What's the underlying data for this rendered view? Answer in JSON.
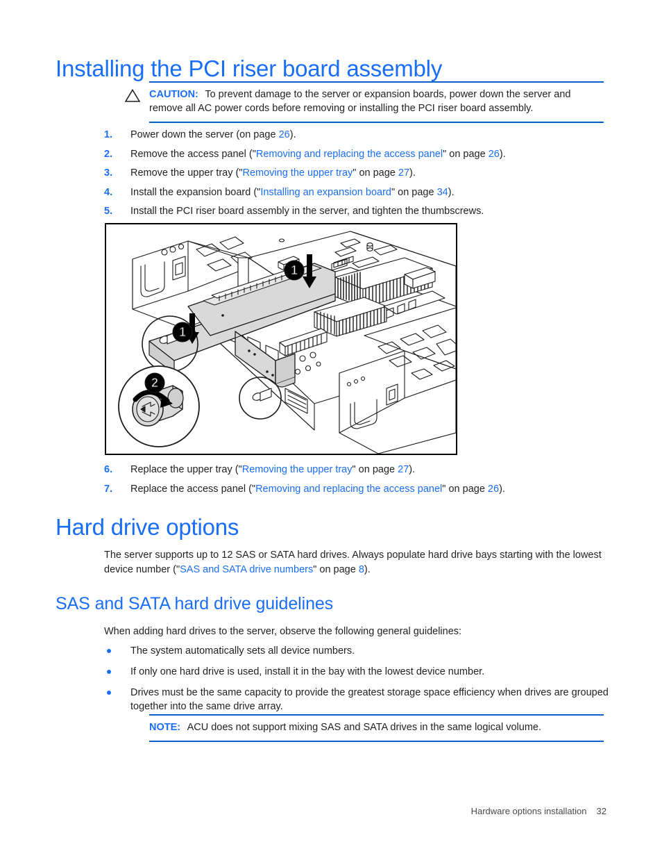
{
  "document": {
    "section_title": "Installing the PCI riser board assembly",
    "caution": {
      "label": "CAUTION:",
      "text": "To prevent damage to the server or expansion boards, power down the server and remove all AC power cords before removing or installing the PCI riser board assembly.",
      "icon": "warning-triangle-icon"
    },
    "steps_before_figure": [
      {
        "number": "1.",
        "parts": [
          {
            "type": "text",
            "value": "Power down the server (on page "
          },
          {
            "type": "link",
            "value": "26"
          },
          {
            "type": "text",
            "value": ")."
          }
        ]
      },
      {
        "number": "2.",
        "parts": [
          {
            "type": "text",
            "value": "Remove the access panel (\""
          },
          {
            "type": "link",
            "value": "Removing and replacing the access panel"
          },
          {
            "type": "text",
            "value": "\" on page "
          },
          {
            "type": "link",
            "value": "26"
          },
          {
            "type": "text",
            "value": ")."
          }
        ]
      },
      {
        "number": "3.",
        "parts": [
          {
            "type": "text",
            "value": "Remove the upper tray (\""
          },
          {
            "type": "link",
            "value": "Removing the upper tray"
          },
          {
            "type": "text",
            "value": "\" on page "
          },
          {
            "type": "link",
            "value": "27"
          },
          {
            "type": "text",
            "value": ")."
          }
        ]
      },
      {
        "number": "4.",
        "parts": [
          {
            "type": "text",
            "value": "Install the expansion board (\""
          },
          {
            "type": "link",
            "value": "Installing an expansion board"
          },
          {
            "type": "text",
            "value": "\" on page "
          },
          {
            "type": "link",
            "value": "34"
          },
          {
            "type": "text",
            "value": ")."
          }
        ]
      },
      {
        "number": "5.",
        "parts": [
          {
            "type": "text",
            "value": "Install the PCI riser board assembly in the server, and tighten the thumbscrews."
          }
        ]
      }
    ],
    "figure": {
      "alt": "Exploded view of server chassis showing PCI riser board assembly being lowered into the server and a magnified detail of the thumbscrew being turned",
      "callouts": [
        {
          "number": "1",
          "meaning": "lower-riser-board-assembly-into-server"
        },
        {
          "number": "1",
          "meaning": "lower-riser-board-assembly-into-server"
        },
        {
          "number": "2",
          "meaning": "tighten-thumbscrew"
        }
      ]
    },
    "steps_after_figure": [
      {
        "number": "6.",
        "parts": [
          {
            "type": "text",
            "value": "Replace the upper tray (\""
          },
          {
            "type": "link",
            "value": "Removing the upper tray"
          },
          {
            "type": "text",
            "value": "\" on page "
          },
          {
            "type": "link",
            "value": "27"
          },
          {
            "type": "text",
            "value": ")."
          }
        ]
      },
      {
        "number": "7.",
        "parts": [
          {
            "type": "text",
            "value": "Replace the access panel (\""
          },
          {
            "type": "link",
            "value": "Removing and replacing the access panel"
          },
          {
            "type": "text",
            "value": "\" on page "
          },
          {
            "type": "link",
            "value": "26"
          },
          {
            "type": "text",
            "value": ")."
          }
        ]
      }
    ],
    "hard_drive_options": {
      "title": "Hard drive options",
      "paragraph_parts": [
        {
          "type": "text",
          "value": "The server supports up to 12 SAS or SATA hard drives. Always populate hard drive bays starting with the lowest device number (\""
        },
        {
          "type": "link",
          "value": "SAS and SATA drive numbers"
        },
        {
          "type": "text",
          "value": "\" on page "
        },
        {
          "type": "link",
          "value": "8"
        },
        {
          "type": "text",
          "value": ")."
        }
      ]
    },
    "guidelines": {
      "title": "SAS and SATA hard drive guidelines",
      "intro": "When adding hard drives to the server, observe the following general guidelines:",
      "items": [
        "The system automatically sets all device numbers.",
        "If only one hard drive is used, install it in the bay with the lowest device number.",
        "Drives must be the same capacity to provide the greatest storage space efficiency when drives are grouped together into the same drive array."
      ]
    },
    "note": {
      "label": "NOTE:",
      "text": "ACU does not support mixing SAS and SATA drives in the same logical volume."
    },
    "footer": {
      "text": "Hardware options installation",
      "page_number": "32"
    },
    "colors": {
      "heading_blue": "#1a6ef5",
      "link_blue": "#1a6ef5",
      "rule_blue": "#0a60c8",
      "body_black": "#231f20"
    }
  }
}
